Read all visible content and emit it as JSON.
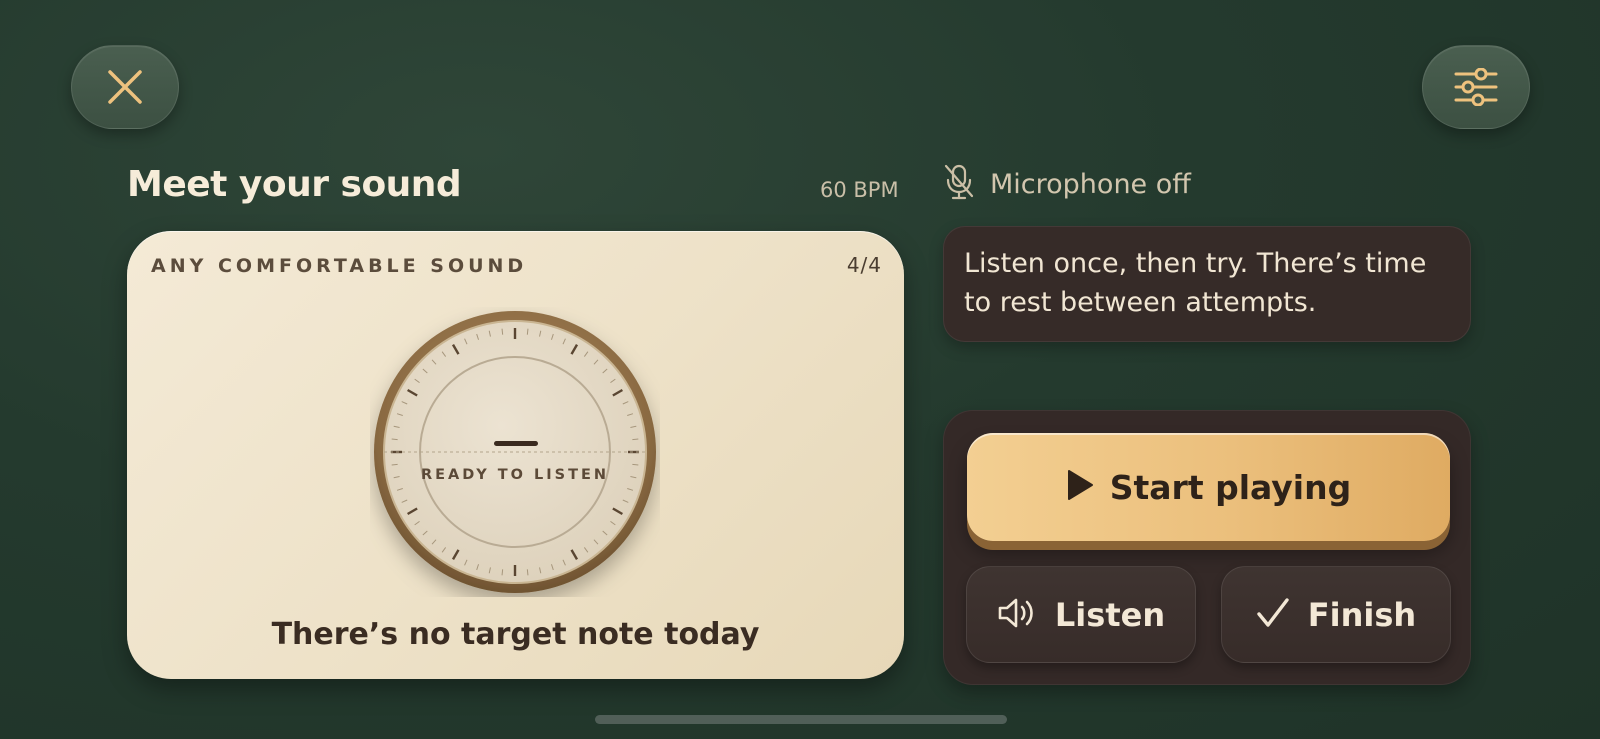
{
  "top_bar": {
    "close_icon": "close-x-icon",
    "settings_icon": "sliders-icon"
  },
  "header": {
    "title": "Meet your sound",
    "bpm": "60 BPM"
  },
  "sound_card": {
    "label": "ANY COMFORTABLE SOUND",
    "count": "4/4",
    "dial_status": "READY TO LISTEN",
    "message": "There’s no target note today"
  },
  "mic": {
    "icon": "microphone-off-icon",
    "label": "Microphone off"
  },
  "info": {
    "text": "Listen once, then try. There’s time to rest between attempts."
  },
  "controls": {
    "start_label": "Start playing",
    "listen_label": "Listen",
    "finish_label": "Finish"
  },
  "colors": {
    "background": "#243a2e",
    "card": "#efe3ca",
    "accent_gold": "#ebbf7c",
    "panel": "#342927",
    "icon_gold": "#eec27e"
  }
}
